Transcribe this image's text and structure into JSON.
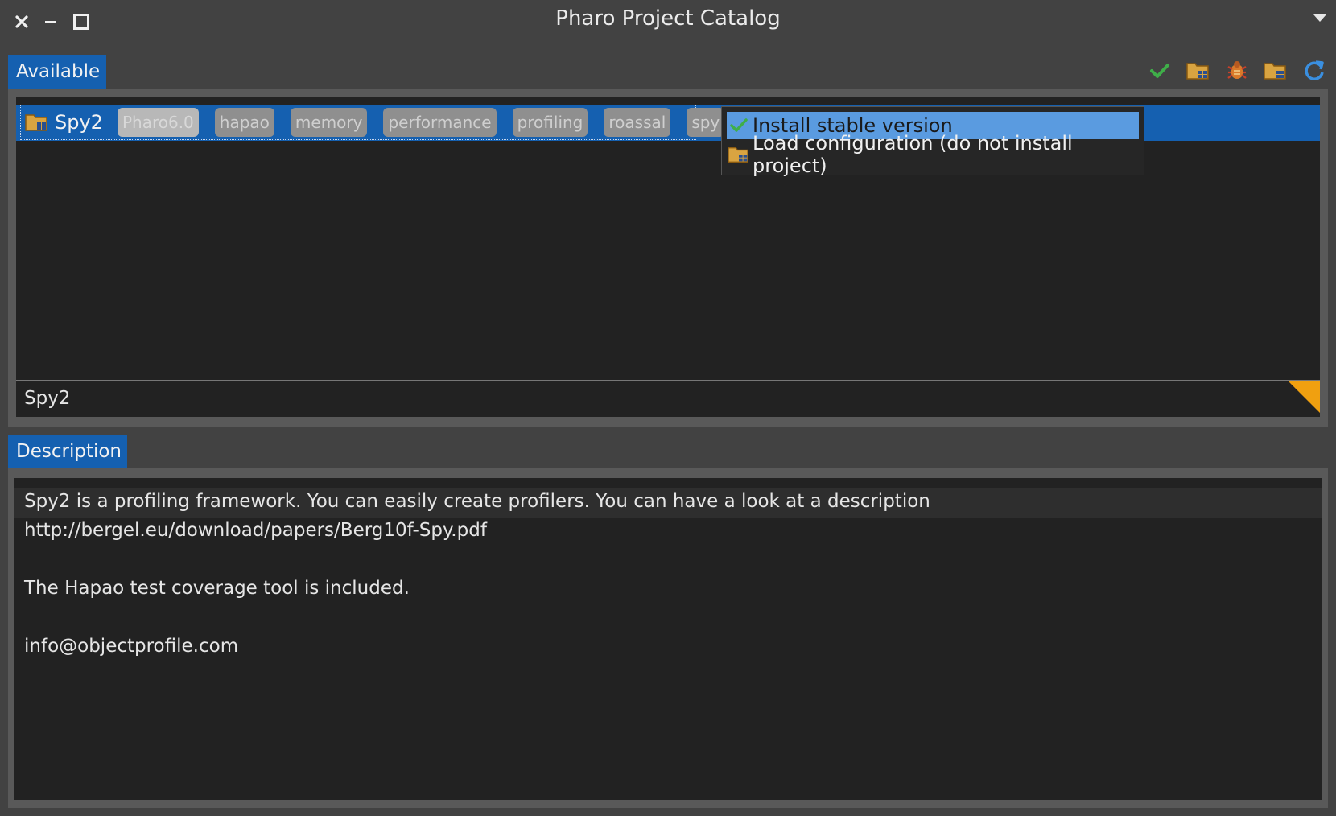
{
  "window": {
    "title": "Pharo Project Catalog",
    "controls": [
      "close-icon",
      "minimize-icon",
      "maximize-icon",
      "window-menu-icon"
    ]
  },
  "available": {
    "tab_label": "Available",
    "toolbar": [
      "checkmark-icon",
      "folder-config-icon",
      "bug-icon",
      "folder-config-icon",
      "refresh-icon"
    ],
    "project": {
      "name": "Spy2",
      "tags": [
        "Pharo6.0",
        "hapao",
        "memory",
        "performance",
        "profiling",
        "roassal",
        "spy"
      ]
    },
    "filter_value": "Spy2"
  },
  "context_menu": {
    "items": [
      {
        "label": "Install stable version",
        "icon": "checkmark-icon"
      },
      {
        "label": "Load configuration (do not install project)",
        "icon": "folder-config-icon"
      }
    ]
  },
  "description": {
    "tab_label": "Description",
    "lines": [
      "Spy2 is a profiling framework. You can easily create profilers. You can have a look at a description",
      "http://bergel.eu/download/papers/Berg10f-Spy.pdf",
      "",
      "The Hapao test coverage tool is included.",
      "",
      "info@objectprofile.com"
    ]
  },
  "colors": {
    "selection": "#1560b0",
    "menu_highlight": "#5a9be0",
    "panel_bg": "#222222",
    "chrome_bg": "#424242",
    "accent_orange": "#f0a010"
  }
}
